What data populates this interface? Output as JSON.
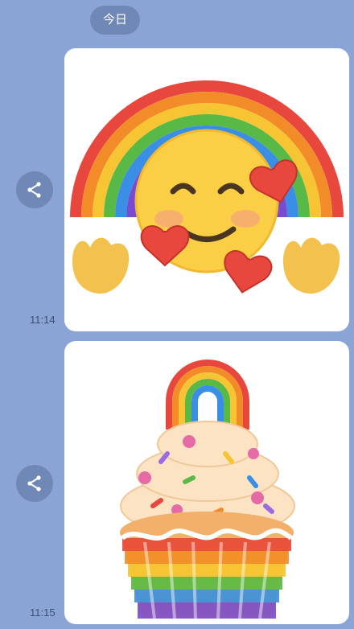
{
  "date_divider": "今日",
  "messages": [
    {
      "time": "11:14",
      "sticker": "rainbow-hearts-smiley-sticker",
      "share_icon": "share-icon"
    },
    {
      "time": "11:15",
      "sticker": "rainbow-cupcake-sticker",
      "share_icon": "share-icon"
    }
  ],
  "colors": {
    "background": "#8aa4d5",
    "pill": "#7088b6",
    "time_text": "#3c4f73",
    "card": "#ffffff"
  }
}
